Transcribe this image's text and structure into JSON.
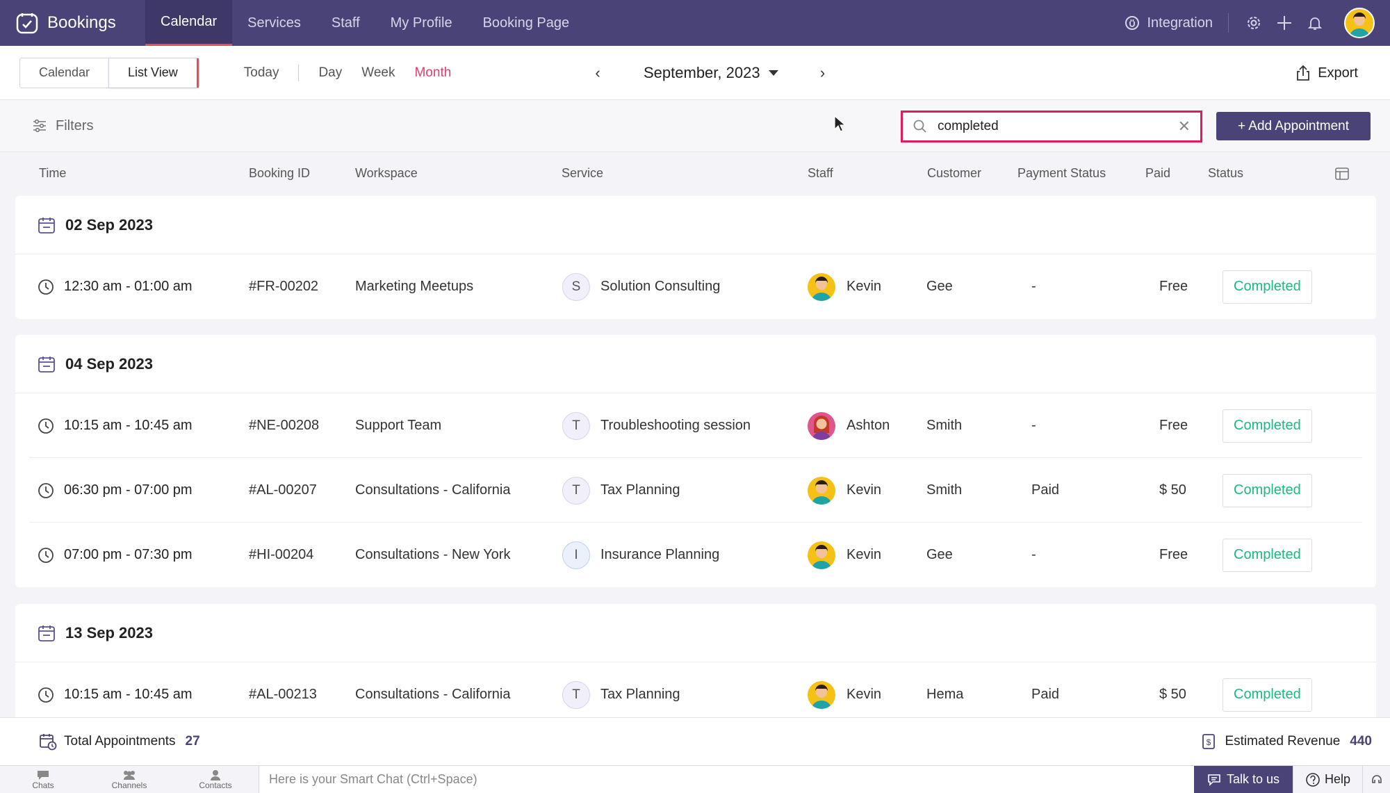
{
  "app": {
    "name": "Bookings"
  },
  "nav": {
    "tabs": [
      "Calendar",
      "Services",
      "Staff",
      "My Profile",
      "Booking Page"
    ],
    "integration": "Integration"
  },
  "toolbar": {
    "view_calendar": "Calendar",
    "view_list": "List View",
    "today": "Today",
    "day": "Day",
    "week": "Week",
    "month": "Month",
    "current_month": "September, 2023",
    "export": "Export"
  },
  "filterbar": {
    "filters": "Filters",
    "search_value": "completed",
    "add_appointment": "+ Add Appointment"
  },
  "columns": {
    "time": "Time",
    "booking_id": "Booking ID",
    "workspace": "Workspace",
    "service": "Service",
    "staff": "Staff",
    "customer": "Customer",
    "payment_status": "Payment Status",
    "paid": "Paid",
    "status": "Status"
  },
  "groups": [
    {
      "date": "02 Sep 2023",
      "rows": [
        {
          "time": "12:30 am - 01:00 am",
          "id": "#FR-00202",
          "workspace": "Marketing Meetups",
          "service_initial": "S",
          "service": "Solution Consulting",
          "staff": "Kevin",
          "customer": "Gee",
          "payment_status": "-",
          "paid": "Free",
          "status": "Completed"
        }
      ]
    },
    {
      "date": "04 Sep 2023",
      "rows": [
        {
          "time": "10:15 am - 10:45 am",
          "id": "#NE-00208",
          "workspace": "Support Team",
          "service_initial": "T",
          "service": "Troubleshooting session",
          "staff": "Ashton",
          "customer": "Smith",
          "payment_status": "-",
          "paid": "Free",
          "status": "Completed"
        },
        {
          "time": "06:30 pm - 07:00 pm",
          "id": "#AL-00207",
          "workspace": "Consultations - California",
          "service_initial": "T",
          "service": "Tax Planning",
          "staff": "Kevin",
          "customer": "Smith",
          "payment_status": "Paid",
          "paid": "$ 50",
          "status": "Completed"
        },
        {
          "time": "07:00 pm - 07:30 pm",
          "id": "#HI-00204",
          "workspace": "Consultations - New York",
          "service_initial": "I",
          "service": "Insurance Planning",
          "staff": "Kevin",
          "customer": "Gee",
          "payment_status": "-",
          "paid": "Free",
          "status": "Completed"
        }
      ]
    },
    {
      "date": "13 Sep 2023",
      "rows": [
        {
          "time": "10:15 am - 10:45 am",
          "id": "#AL-00213",
          "workspace": "Consultations - California",
          "service_initial": "T",
          "service": "Tax Planning",
          "staff": "Kevin",
          "customer": "Hema",
          "payment_status": "Paid",
          "paid": "$ 50",
          "status": "Completed"
        }
      ]
    }
  ],
  "footer": {
    "total_label": "Total Appointments",
    "total_value": "27",
    "revenue_label": "Estimated Revenue",
    "revenue_value": "440"
  },
  "bottombar": {
    "chats": "Chats",
    "channels": "Channels",
    "contacts": "Contacts",
    "chat_placeholder": "Here is your Smart Chat (Ctrl+Space)",
    "talk": "Talk to us",
    "help": "Help"
  },
  "colors": {
    "primary": "#4a4377",
    "accent": "#e3195b",
    "completed": "#1bb980"
  }
}
